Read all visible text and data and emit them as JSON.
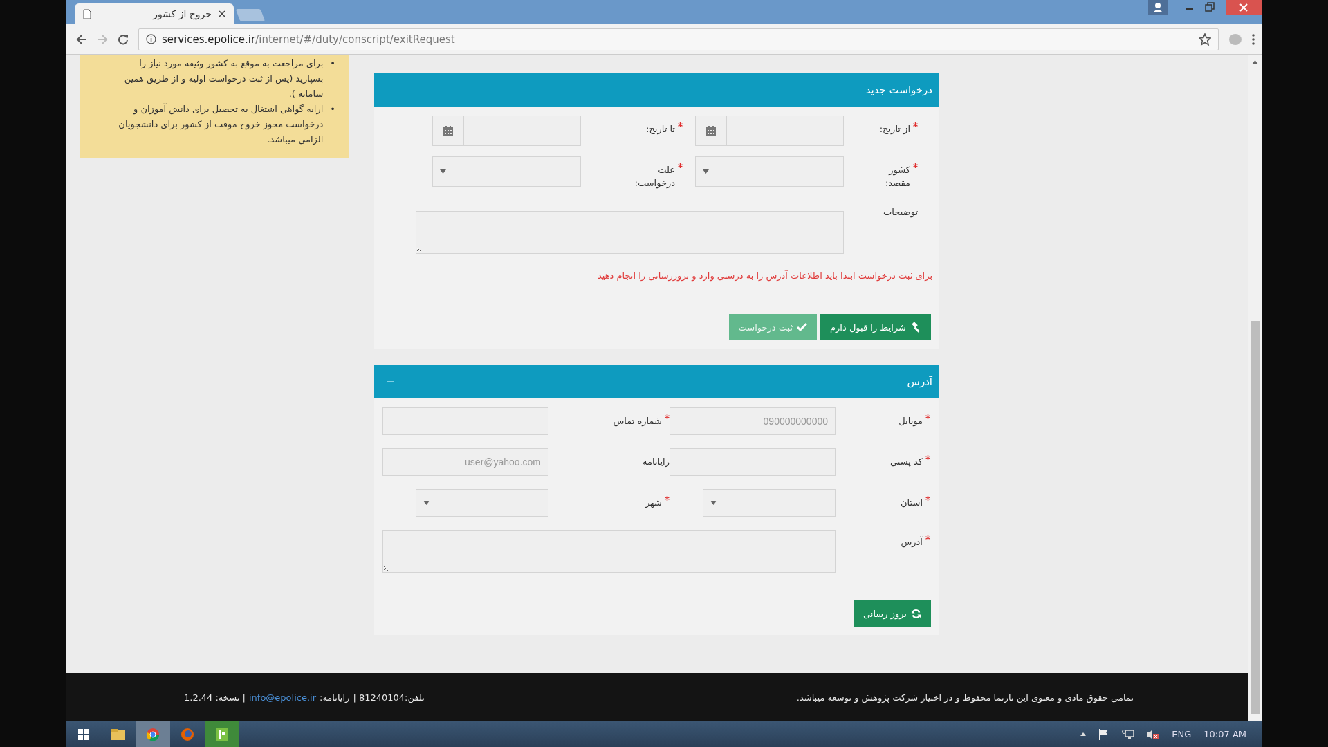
{
  "browser": {
    "tab_title": "خروج از کشور",
    "url_host": "services.epolice.ir",
    "url_path": "/internet/#/duty/conscript/exitRequest"
  },
  "notice": {
    "items": [
      {
        "marker": "•",
        "text": "برای مراجعت به موقع به کشور وثیقه مورد نیاز را بسپارید (پس از ثبت درخواست اولیه و از طریق همین سامانه )."
      },
      {
        "marker": "•",
        "text": "ارایه گواهی اشتغال به تحصیل برای دانش آموزان و درخواست مجوز خروج موقت از کشور برای دانشجویان الزامی میباشد."
      }
    ]
  },
  "request_panel": {
    "title": "درخواست جدید",
    "fields": [
      {
        "label": "از تاریخ:",
        "required": true,
        "kind": "date"
      },
      {
        "label": "تا تاریخ:",
        "required": true,
        "kind": "date"
      },
      {
        "label": "کشور مقصد:",
        "required": true,
        "kind": "select"
      },
      {
        "label": "علت درخواست:",
        "required": true,
        "kind": "select"
      },
      {
        "label": "توضیحات",
        "required": false,
        "kind": "textarea"
      }
    ],
    "warning": "برای ثبت درخواست ابتدا باید اطلاعات آدرس را به درستی وارد و بروزرسانی را انجام دهید",
    "buttons": [
      {
        "label": "شرایط را قبول دارم",
        "kind": "accept",
        "disabled": false
      },
      {
        "label": "ثبت درخواست",
        "kind": "submit",
        "disabled": true
      }
    ]
  },
  "address_panel": {
    "title": "آدرس",
    "fields": [
      {
        "label": "موبایل",
        "required": true,
        "kind": "text",
        "placeholder": "090000000000"
      },
      {
        "label": "شماره تماس",
        "required": true,
        "kind": "text"
      },
      {
        "label": "کد پستی",
        "required": true,
        "kind": "text"
      },
      {
        "label": "رایانامه",
        "required": false,
        "kind": "text",
        "placeholder": "user@yahoo.com"
      },
      {
        "label": "استان",
        "required": true,
        "kind": "select"
      },
      {
        "label": "شهر",
        "required": true,
        "kind": "select"
      },
      {
        "label": "آدرس",
        "required": true,
        "kind": "textarea"
      }
    ],
    "buttons": [
      {
        "label": "بروز رسانی",
        "kind": "update",
        "disabled": false
      }
    ]
  },
  "footer": {
    "copyright": "تمامی حقوق مادی و معنوی این تارنما محفوظ و در اختیار شرکت پژوهش و توسعه میباشد.",
    "phone": "تلفن:81240104 |",
    "email_label": "رایانامه:",
    "email": "info@epolice.ir",
    "version": "| نسخه: 1.2.44"
  },
  "taskbar": {
    "language": "ENG",
    "time": "10:07 AM"
  }
}
